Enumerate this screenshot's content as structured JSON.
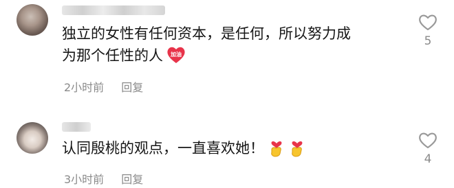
{
  "comments": [
    {
      "text_line1": "独立的女性有任何资本，是任何，所以努力成",
      "text_line2": "为那个任性的人",
      "emoji_badge_text": "加油",
      "time": "2小时前",
      "reply_label": "回复",
      "like_count": "5"
    },
    {
      "text_line1": "认同殷桃的观点，一直喜欢她！",
      "time": "3小时前",
      "reply_label": "回复",
      "like_count": "4"
    }
  ],
  "icons": {
    "like": "heart-outline-icon",
    "emoji_1": "cheer-badge-emoji",
    "emoji_2": "finger-heart-emoji"
  },
  "colors": {
    "meta_text": "#8a8a8a",
    "content_text": "#161616",
    "badge_red": "#e8344a"
  }
}
